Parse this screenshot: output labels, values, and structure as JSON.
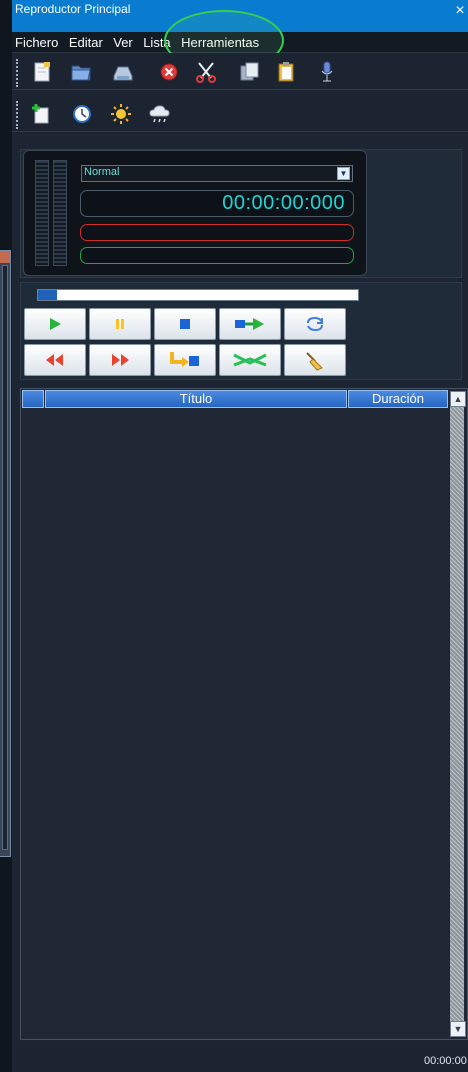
{
  "window": {
    "title": "Reproductor Principal",
    "close_glyph": "×"
  },
  "menu": {
    "items": [
      "Fichero",
      "Editar",
      "Ver",
      "Lista",
      "Herramientas"
    ]
  },
  "toolbar1": {
    "icons": [
      "new-file-icon",
      "open-folder-icon",
      "save-icon",
      "delete-icon",
      "cut-icon",
      "copy-icon",
      "paste-icon",
      "microphone-icon"
    ]
  },
  "toolbar2": {
    "icons": [
      "add-item-icon",
      "clock-icon",
      "sun-icon",
      "cloud-rain-icon"
    ]
  },
  "player": {
    "mode": "Normal",
    "timer": "00:00:00:000"
  },
  "transport": {
    "progress_fraction": 0.06,
    "buttons_row1": [
      "play-icon",
      "pause-icon",
      "stop-icon",
      "next-track-icon",
      "loop-icon"
    ],
    "buttons_row2": [
      "rewind-icon",
      "fast-forward-icon",
      "insert-icon",
      "crossfade-icon",
      "clear-icon"
    ]
  },
  "playlist": {
    "columns": [
      "",
      "Título",
      "Duración"
    ]
  },
  "status": {
    "total_time": "00:00:00"
  },
  "colors": {
    "title_bar": "#0a7ccf",
    "timer_text": "#20d4d4",
    "highlight": "#35d14c"
  }
}
